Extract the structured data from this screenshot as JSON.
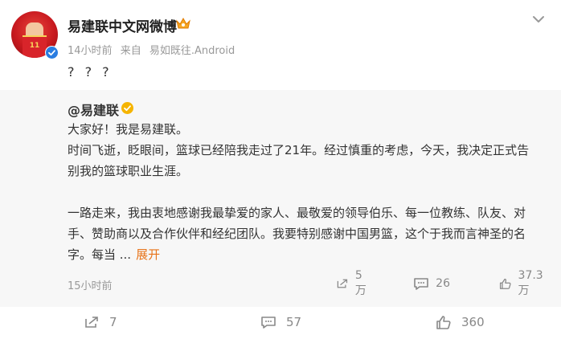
{
  "post": {
    "author": "易建联中文网微博",
    "meta_time": "14小时前",
    "meta_source_prefix": "来自",
    "meta_source": "易如既往.Android",
    "content": "? ? ?",
    "badge_icon": "crown-icon",
    "more_icon": "chevron-down-icon"
  },
  "repost": {
    "author": "@易建联",
    "lines": [
      "大家好！我是易建联。",
      "时间飞逝，眨眼间，篮球已经陪我走过了21年。经过慎重的考虑，今天，我决定正式告",
      "别我的篮球职业生涯。",
      "",
      "一路走来，我由衷地感谢我最挚爱的家人、最敬爱的领导伯乐、每一位教练、队友、对",
      "手、赞助商以及合作伙伴和经纪团队。我要特别感谢中国男篮，这个于我而言神圣的名",
      "字。每当 ..."
    ],
    "expand_label": "展开",
    "time": "15小时前",
    "reposts": "5万",
    "comments": "26",
    "likes": "37.3万"
  },
  "footer": {
    "reposts": "7",
    "comments": "57",
    "likes": "360"
  },
  "colors": {
    "accent_orange": "#e8741a",
    "verified_blue": "#2a7de1",
    "verified_gold": "#f5b400",
    "muted": "#999999"
  }
}
